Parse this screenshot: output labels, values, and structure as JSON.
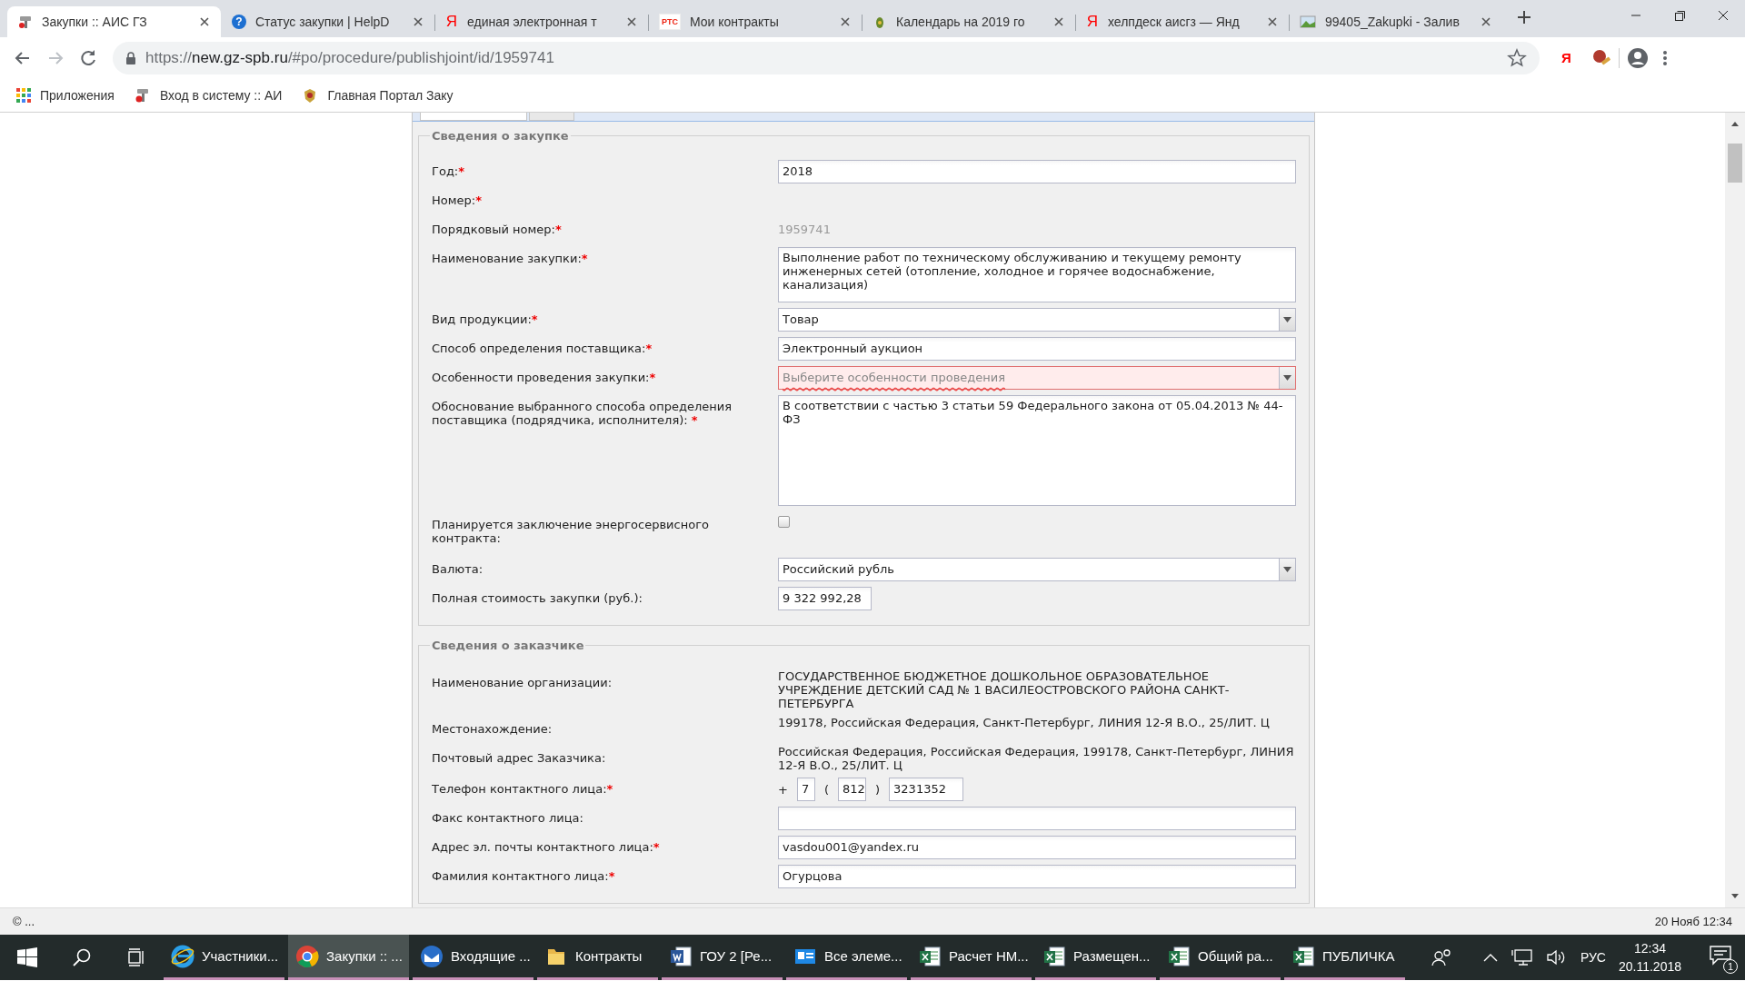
{
  "browser": {
    "tabs": [
      {
        "title": "Закупки :: АИС ГЗ",
        "selected": true,
        "kind": "tool"
      },
      {
        "title": "Статус закупки | HelpD",
        "selected": false,
        "kind": "help",
        "icon_text": "?"
      },
      {
        "title": "единая электронная т",
        "selected": false,
        "kind": "yandex",
        "icon_text": "Я"
      },
      {
        "title": "Мои контракты",
        "selected": false,
        "kind": "rts",
        "icon_text": "РТС"
      },
      {
        "title": "Календарь на 2019 го",
        "selected": false,
        "kind": "calendar"
      },
      {
        "title": "хелпдеск аисгз — Янд",
        "selected": false,
        "kind": "yandex",
        "icon_text": "Я"
      },
      {
        "title": "99405_Zakupki - Залив",
        "selected": false,
        "kind": "image"
      }
    ],
    "url": {
      "scheme": "https://",
      "host": "new.gz-spb.ru",
      "path": "/#po/procedure/publishjoint/id/1959741"
    },
    "extension_text": "Я",
    "bookmarks": [
      {
        "label": "Приложения",
        "kind": "apps"
      },
      {
        "label": "Вход в систему :: АИ",
        "kind": "tool"
      },
      {
        "label": "Главная Портал Заку",
        "kind": "emblem"
      }
    ]
  },
  "form": {
    "sections": [
      {
        "legend": "Сведения о закупке",
        "rows": [
          {
            "label": "Год:",
            "required_mark": "*",
            "kind": "text",
            "value": "2018"
          },
          {
            "label": "Номер:",
            "required_mark": "*",
            "kind": "none"
          },
          {
            "label": "Порядковый номер:",
            "required_mark": "*",
            "kind": "readonly",
            "value": "1959741"
          },
          {
            "label": "Наименование закупки:",
            "required_mark": "*",
            "kind": "textarea",
            "value": "Выполнение работ по техническому обслуживанию и текущему ремонту инженерных сетей (отопление, холодное и горячее водоснабжение, канализация)"
          },
          {
            "label": "Вид продукции:",
            "required_mark": "*",
            "kind": "select",
            "value": "Товар",
            "invalid": false
          },
          {
            "label": "Способ определения поставщика:",
            "required_mark": "*",
            "kind": "text",
            "value": "Электронный аукцион"
          },
          {
            "label": "Особенности проведения закупки:",
            "required_mark": "*",
            "kind": "select",
            "placeholder": "Выберите особенности проведения",
            "invalid": true
          },
          {
            "label": "Обоснование выбранного способа определения поставщика (подрядчика, исполнителя): ",
            "required_mark": "*",
            "kind": "long_textarea",
            "value": "В соответствии с частью 3 статьи 59 Федерального закона от 05.04.2013 № 44-ФЗ"
          },
          {
            "label": "Планируется заключение энергосервисного контракта:",
            "kind": "checkbox",
            "checked": false
          },
          {
            "label": "Валюта:",
            "kind": "select",
            "value": "Российский рубль",
            "invalid": false
          },
          {
            "label": "Полная стоимость закупки (руб.):",
            "kind": "short_text",
            "value": "9 322 992,28"
          }
        ]
      },
      {
        "legend": "Сведения о заказчике",
        "rows": [
          {
            "label": "Наименование организации:",
            "kind": "static",
            "value": "ГОСУДАРСТВЕННОЕ БЮДЖЕТНОЕ ДОШКОЛЬНОЕ ОБРАЗОВАТЕЛЬНОЕ УЧРЕЖДЕНИЕ ДЕТСКИЙ САД № 1 ВАСИЛЕОСТРОВСКОГО РАЙОНА САНКТ-ПЕТЕРБУРГА"
          },
          {
            "label": "Местонахождение:",
            "kind": "static",
            "value": "199178, Российская Федерация, Санкт-Петербург, ЛИНИЯ 12-Я В.О., 25/ЛИТ. Ц"
          },
          {
            "label": "Почтовый адрес Заказчика:",
            "kind": "static",
            "value": "Российская Федерация, Российская Федерация, 199178, Санкт-Петербург, ЛИНИЯ 12-Я В.О., 25/ЛИТ. Ц"
          },
          {
            "label": "Телефон контактного лица:",
            "required_mark": "*",
            "kind": "phone",
            "plus": "+",
            "country": "7",
            "open": "(",
            "code": "812",
            "close": ")",
            "number": "3231352"
          },
          {
            "label": "Факс контактного лица:",
            "kind": "text"
          },
          {
            "label": "Адрес эл. почты контактного лица:",
            "required_mark": "*",
            "kind": "text",
            "value": "vasdou001@yandex.ru"
          },
          {
            "label": "Фамилия контактного лица:",
            "required_mark": "*",
            "kind": "text",
            "value": "Огурцова"
          }
        ]
      }
    ]
  },
  "status_bar": {
    "left": "© ...",
    "right": "20 Нояб 12:34"
  },
  "taskbar": {
    "items": [
      {
        "label": "Участники...",
        "kind": "ie",
        "active": false
      },
      {
        "label": "Закупки :: ...",
        "kind": "chrome",
        "active": true
      },
      {
        "label": "Входящие ...",
        "kind": "mail",
        "active": false
      },
      {
        "label": "Контракты",
        "kind": "folder",
        "active": false
      },
      {
        "label": "ГОУ 2 [Ре...",
        "kind": "word",
        "active": false
      },
      {
        "label": "Все элеме...",
        "kind": "card",
        "active": false
      },
      {
        "label": "Расчет НМ...",
        "kind": "excel",
        "active": false
      },
      {
        "label": "Размещен...",
        "kind": "excel",
        "active": false
      },
      {
        "label": "Общий ра...",
        "kind": "excel",
        "active": false
      },
      {
        "label": "ПУБЛИЧКА",
        "kind": "excel",
        "active": false
      }
    ],
    "tray": {
      "language": "РУС",
      "time": "12:34",
      "date": "20.11.2018",
      "notifications": "1"
    }
  }
}
